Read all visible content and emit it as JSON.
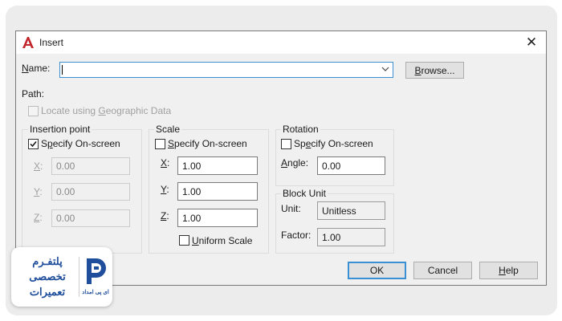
{
  "dialog": {
    "title": "Insert",
    "close_glyph": "✕",
    "icon": "autocad-a-icon",
    "brand_color": "#c1272d"
  },
  "name": {
    "label": "Name:",
    "value": ""
  },
  "browse_label": "Browse...",
  "path_label": "Path:",
  "geo_checkbox": {
    "label": "Locate using Geographic Data",
    "checked": false,
    "enabled": false
  },
  "insertion": {
    "title": "Insertion point",
    "specify": {
      "label": "Specify On-screen",
      "checked": true
    },
    "x": {
      "label": "X:",
      "value": "0.00"
    },
    "y": {
      "label": "Y:",
      "value": "0.00"
    },
    "z": {
      "label": "Z:",
      "value": "0.00"
    }
  },
  "scale": {
    "title": "Scale",
    "specify": {
      "label": "Specify On-screen",
      "checked": false
    },
    "x": {
      "label": "X:",
      "value": "1.00"
    },
    "y": {
      "label": "Y:",
      "value": "1.00"
    },
    "z": {
      "label": "Z:",
      "value": "1.00"
    },
    "uniform": {
      "label": "Uniform Scale",
      "checked": false
    }
  },
  "rotation": {
    "title": "Rotation",
    "specify": {
      "label": "Specify On-screen",
      "checked": false
    },
    "angle": {
      "label": "Angle:",
      "value": "0.00"
    }
  },
  "block_unit": {
    "title": "Block Unit",
    "unit": {
      "label": "Unit:",
      "value": "Unitless"
    },
    "factor": {
      "label": "Factor:",
      "value": "1.00"
    }
  },
  "buttons": {
    "ok": "OK",
    "cancel": "Cancel",
    "help": "Help"
  },
  "watermark": {
    "lines": [
      "پلتفـرم",
      "تخصصی",
      "تعمیرات"
    ],
    "brand": "ای پی امداد",
    "color": "#1f4e9c"
  }
}
